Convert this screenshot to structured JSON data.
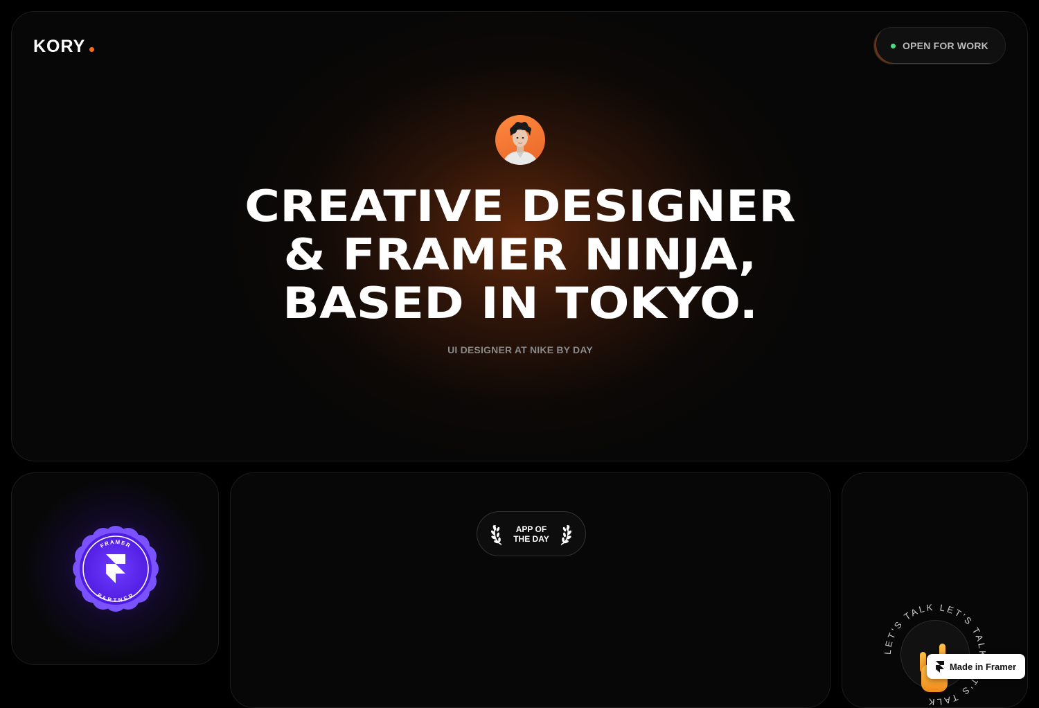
{
  "header": {
    "logo_text": "KORY",
    "status_label": "OPEN FOR WORK"
  },
  "hero": {
    "headline_lines": [
      "CREATIVE DESIGNER",
      "& FRAMER NINJA,",
      "BASED IN TOKYO."
    ],
    "subline": "UI DESIGNER AT NIKE BY DAY"
  },
  "partner_badge": {
    "top_text": "FRAMER",
    "bottom_text": "PARTNER"
  },
  "award": {
    "line1": "APP OF",
    "line2": "THE DAY"
  },
  "talk": {
    "ring_text": "LET'S TALK  LET'S TALK  LET'S TALK  "
  },
  "framer_badge": {
    "label": "Made in Framer"
  },
  "colors": {
    "accent_orange": "#ff6a1a",
    "status_green": "#4ade80",
    "badge_purple": "#6d28ff"
  }
}
